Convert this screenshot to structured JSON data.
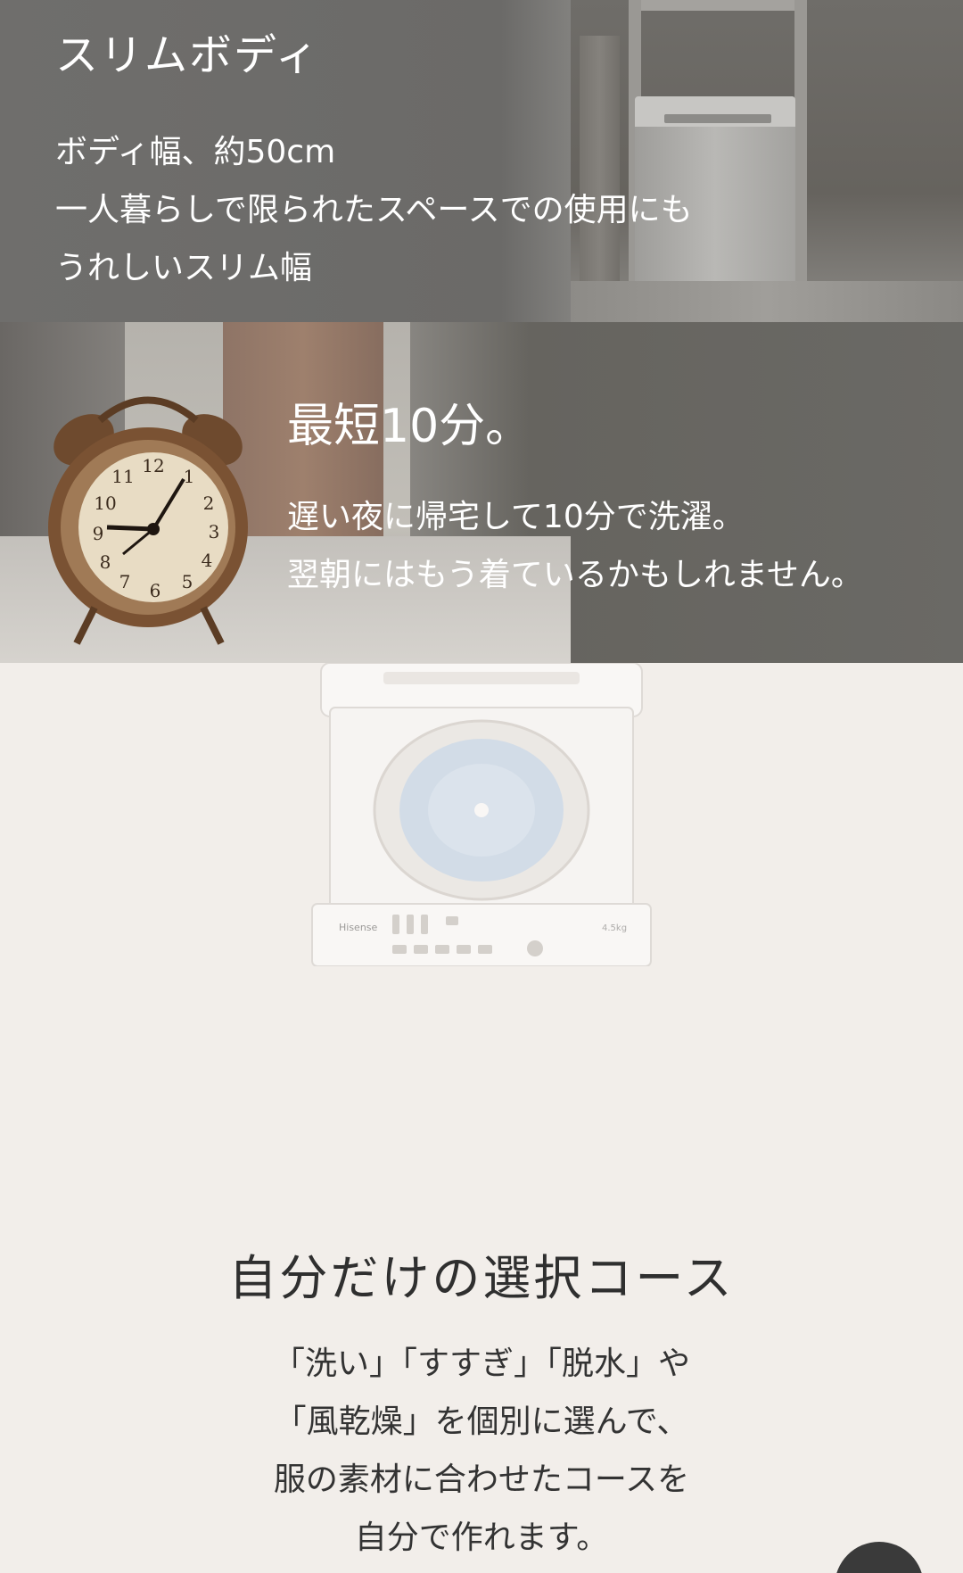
{
  "slim_body": {
    "title": "スリムボディ",
    "lines": [
      "ボディ幅、約50cm",
      "一人暮らしで限られたスペースでの使用にも",
      "うれしいスリム幅"
    ]
  },
  "quick_wash": {
    "title": "最短10分。",
    "lines": [
      "遅い夜に帰宅して10分で洗濯。",
      "翌朝にはもう着ているかもしれません。"
    ]
  },
  "washer_image": {
    "brand": "Hisense",
    "capacity": "4.5kg"
  },
  "custom_course": {
    "title": "自分だけの選択コース",
    "lines": [
      "「洗い」「すすぎ」「脱水」や",
      "「風乾燥」を個別に選んで、",
      "服の素材に合わせたコースを",
      "自分で作れます。"
    ]
  },
  "colors": {
    "page_background": "#f2eeea",
    "overlay_text": "#ffffff",
    "body_text": "#333333"
  }
}
